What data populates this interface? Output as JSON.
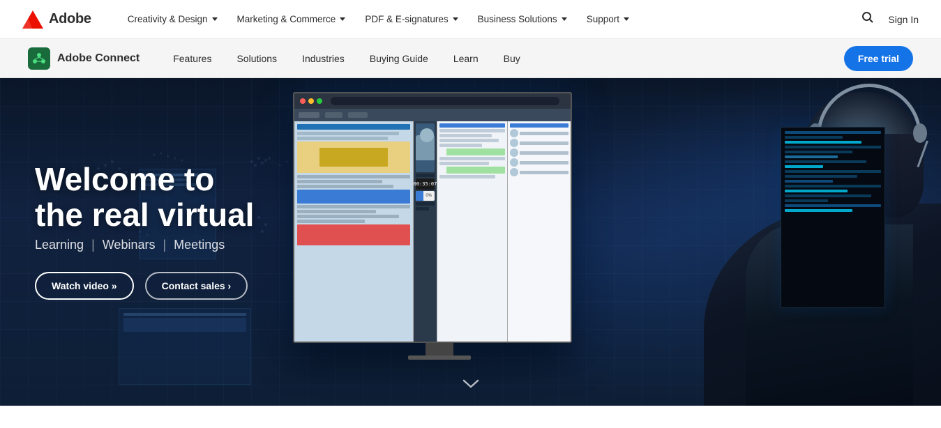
{
  "topnav": {
    "brand": {
      "logo_label": "Adobe logo",
      "wordmark": "Adobe"
    },
    "links": [
      {
        "id": "creativity-design",
        "label": "Creativity & Design",
        "has_dropdown": true
      },
      {
        "id": "marketing-commerce",
        "label": "Marketing & Commerce",
        "has_dropdown": true
      },
      {
        "id": "pdf-esignatures",
        "label": "PDF & E-signatures",
        "has_dropdown": true
      },
      {
        "id": "business-solutions",
        "label": "Business Solutions",
        "has_dropdown": true
      },
      {
        "id": "support",
        "label": "Support",
        "has_dropdown": true
      }
    ],
    "search_label": "Search",
    "sign_in_label": "Sign In"
  },
  "subnav": {
    "product_name": "Adobe Connect",
    "product_icon_label": "Adobe Connect icon",
    "links": [
      {
        "id": "features",
        "label": "Features"
      },
      {
        "id": "solutions",
        "label": "Solutions"
      },
      {
        "id": "industries",
        "label": "Industries"
      },
      {
        "id": "buying-guide",
        "label": "Buying Guide"
      },
      {
        "id": "learn",
        "label": "Learn"
      },
      {
        "id": "buy",
        "label": "Buy"
      }
    ],
    "cta_label": "Free trial"
  },
  "hero": {
    "title_line1": "Welcome to",
    "title_line2": "the real virtual",
    "subtitle_parts": [
      "Learning",
      "Webinars",
      "Meetings"
    ],
    "subtitle_separator": "|",
    "btn_watch_video": "Watch video »",
    "btn_contact_sales": "Contact sales ›",
    "scroll_indicator": "⌄"
  },
  "colors": {
    "adobe_red": "#eb1000",
    "nav_bg": "#ffffff",
    "sub_nav_bg": "#f5f5f5",
    "cta_blue": "#1473e6",
    "hero_dark": "#0a1628",
    "connect_green": "#1a6b3c"
  }
}
